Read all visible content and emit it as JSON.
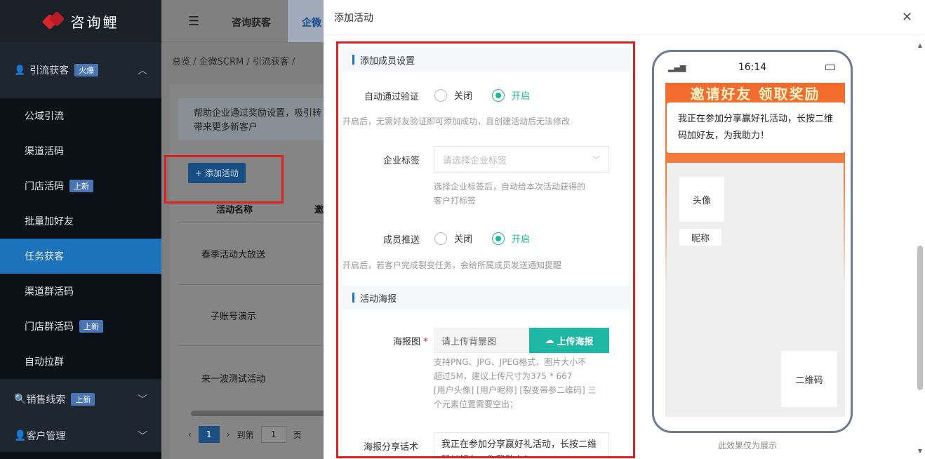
{
  "brand": {
    "name": "咨询鲤"
  },
  "sidebar": {
    "group1": {
      "label": "引流获客",
      "badge": "火爆"
    },
    "items": [
      {
        "label": "公域引流",
        "badge": ""
      },
      {
        "label": "渠道活码",
        "badge": ""
      },
      {
        "label": "门店活码",
        "badge": "上新"
      },
      {
        "label": "批量加好友",
        "badge": ""
      },
      {
        "label": "任务获客",
        "badge": ""
      },
      {
        "label": "渠道群活码",
        "badge": ""
      },
      {
        "label": "门店群活码",
        "badge": "上新"
      },
      {
        "label": "自动拉群",
        "badge": ""
      }
    ],
    "group2": {
      "label": "销售线索",
      "badge": "上新"
    },
    "group3": {
      "label": "客户管理"
    }
  },
  "topbar": {
    "tabs": [
      "咨询获客",
      "企微"
    ]
  },
  "breadcrumb": "总览  /  企微SCRM  /  引流获客  /",
  "page": {
    "tip": "帮助企业通过奖励设置，吸引转\n带来更多新客户",
    "tip_line1": "帮助企业通过奖励设置，吸引转",
    "tip_line2": "带来更多新客户",
    "add_button": "+ 添加活动",
    "col_name": "活动名称",
    "col_2": "邀",
    "rows": [
      "春季活动大放送",
      "子账号演示",
      "来一波测试活动"
    ],
    "pager": {
      "current": "1",
      "goto": "到第",
      "goto_value": "1",
      "page_suffix": "页"
    }
  },
  "drawer": {
    "title": "添加活动",
    "section1": "添加成员设置",
    "auto_verify_label": "自动通过验证",
    "opt_off": "关闭",
    "opt_on": "开启",
    "auto_verify_hint": "开启后，无需好友验证即可添加成功，且创建活动后无法修改",
    "tag_label": "企业标签",
    "tag_placeholder": "请选择企业标签",
    "tag_hint1": "选择企业标签后，自动给本次活动获得的",
    "tag_hint2": "客户打标签",
    "push_label": "成员推送",
    "push_hint": "开启后，若客户完成裂变任务，会给所属成员发送通知提醒",
    "section2": "活动海报",
    "poster_label": "海报图",
    "required_mark": "*",
    "poster_placeholder": "请上传背景图",
    "upload_button": "上传海报",
    "poster_hint1": "支持PNG、JPG、JPEG格式，图片大小不",
    "poster_hint2": "超过5M，建议上传尺寸为375 * 667",
    "poster_hint3": "[用户头像] [用户昵称] [裂变带参二维码] 三",
    "poster_hint4": "个元素位置需要空出；",
    "share_label": "海报分享话术",
    "share_text": "我正在参加分享赢好礼活动，长按二维码加好友，为我助力！"
  },
  "preview": {
    "time": "16:14",
    "banner": "邀请好友  领取奖励",
    "bubble": "我正在参加分享赢好礼活动，长按二维码加好友，为我助力！",
    "avatar": "头像",
    "nickname": "昵称",
    "qrcode": "二维码",
    "note": "此效果仅为展示"
  },
  "colors": {
    "accent": "#1d73bb",
    "green": "#19b89a",
    "teal_button": "#1fb8a4",
    "highlight": "#e02020"
  }
}
